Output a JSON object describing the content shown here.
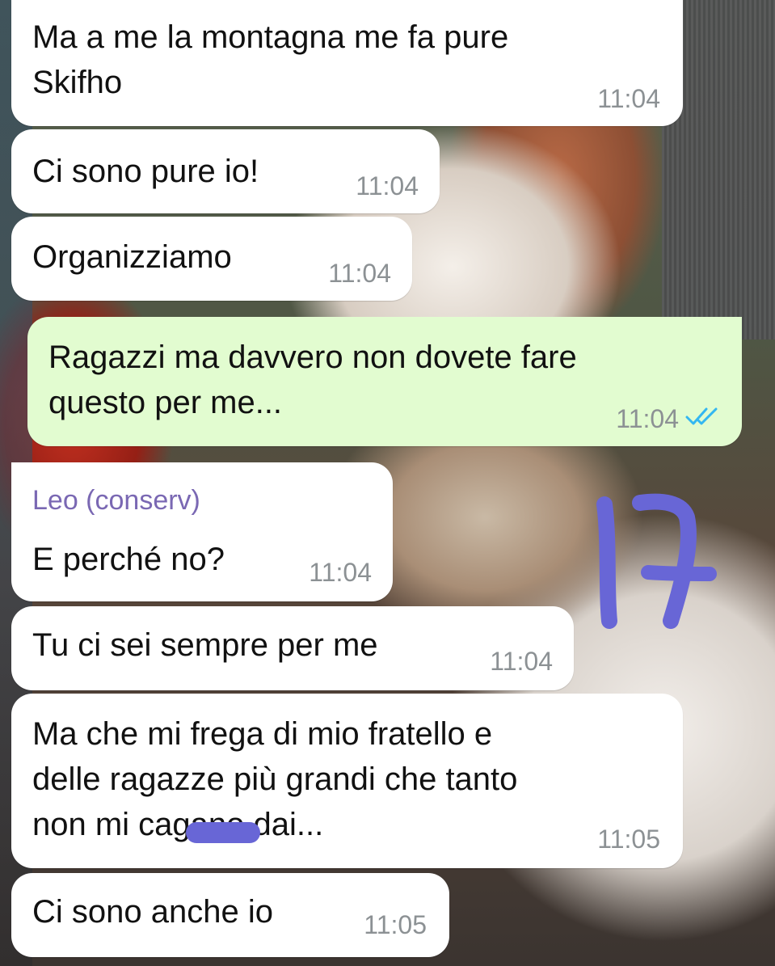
{
  "chat": {
    "messages": [
      {
        "text": "Ma a me la montagna me fa pure\nSkifho",
        "time": "11:04",
        "direction": "incoming"
      },
      {
        "text": "Ci sono pure io!",
        "time": "11:04",
        "direction": "incoming"
      },
      {
        "text": "Organizziamo",
        "time": "11:04",
        "direction": "incoming"
      },
      {
        "text": "Ragazzi ma davvero non dovete fare\nquesto per me...",
        "time": "11:04",
        "direction": "outgoing",
        "status": "read"
      },
      {
        "sender": "Leo (conserv)",
        "text": "E perché no?",
        "time": "11:04",
        "direction": "incoming"
      },
      {
        "text": "Tu ci sei sempre per me",
        "time": "11:04",
        "direction": "incoming"
      },
      {
        "text": "Ma che mi frega di mio fratello e\ndelle ragazze più grandi che tanto\nnon mi cagano dai...",
        "time": "11:05",
        "direction": "incoming"
      },
      {
        "text": "Ci sono anche io",
        "time": "11:05",
        "direction": "incoming"
      }
    ]
  },
  "annotation": {
    "text": "17",
    "color": "#6866d6"
  },
  "colors": {
    "incoming_bubble": "#ffffff",
    "outgoing_bubble": "#e2fcd0",
    "timestamp": "#8c9194",
    "sender_name": "#7a68b3",
    "read_ticks": "#34b7f1"
  },
  "icons": {
    "read_receipt": "double-check-icon"
  }
}
